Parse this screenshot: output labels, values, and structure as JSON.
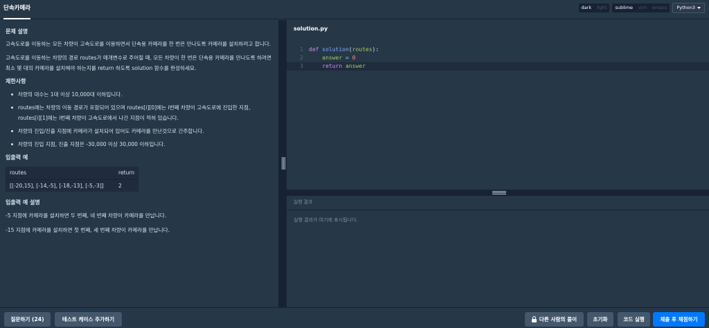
{
  "tab": {
    "title": "단속카메라"
  },
  "toggles": {
    "theme": [
      "dark",
      "light"
    ],
    "keymap": [
      "sublime",
      "vim",
      "emacs"
    ],
    "language": "Python3"
  },
  "problem": {
    "heading": "문제 설명",
    "para1": "고속도로를 이동하는 모든 차량이 고속도로를 이용하면서 단속용 카메라를 한 번은 만나도록 카메라를 설치하려고 합니다.",
    "para2": "고속도로를 이동하는 차량의 경로 routes가 매개변수로 주어질 때, 모든 차량이 한 번은 단속용 카메라를 만나도록 하려면 최소 몇 대의 카메라를 설치해야 하는지를 return 하도록 solution 함수를 완성하세요.",
    "constraints_heading": "제한사항",
    "constraints": [
      "차량의 대수는 1대 이상 10,000대 이하입니다.",
      "routes에는 차량의 이동 경로가 포함되어 있으며 routes[i][0]에는 i번째 차량이 고속도로에 진입한 지점, routes[i][1]에는 i번째 차량이 고속도로에서 나간 지점이 적혀 있습니다.",
      "차량의 진입/진출 지점에 카메라가 설치되어 있어도 카메라를 만난것으로 간주합니다.",
      "차량의 진입 지점, 진출 지점은 -30,000 이상 30,000 이하입니다."
    ],
    "io_heading": "입출력 예",
    "io_table": {
      "headers": [
        "routes",
        "return"
      ],
      "rows": [
        [
          "[[-20,15], [-14,-5], [-18,-13], [-5,-3]]",
          "2"
        ]
      ]
    },
    "io_desc_heading": "입출력 예 설명",
    "io_desc": [
      "-5 지점에 카메라를 설치하면 두 번째, 네 번째 차량이 카메라를 만납니다.",
      "-15 지점에 카메라를 설치하면 첫 번째, 세 번째 차량이 카메라를 만납니다."
    ]
  },
  "editor": {
    "filename": "solution.py",
    "line_numbers": [
      "1",
      "2",
      "3"
    ],
    "code": {
      "l1_def": "def ",
      "l1_fn": "solution",
      "l1_open": "(",
      "l1_param": "routes",
      "l1_close": "):",
      "l2_var": "answer",
      "l2_op": " = ",
      "l2_num": "0",
      "l3_kw": "return ",
      "l3_var": "answer"
    }
  },
  "result": {
    "title": "실행 결과",
    "placeholder": "실행 결과가 여기에 표시됩니다."
  },
  "footer": {
    "ask": "질문하기 (24)",
    "add_testcase": "테스트 케이스 추가하기",
    "others_solution": "다른 사람의 풀이",
    "reset": "초기화",
    "run": "코드 실행",
    "submit": "제출 후 채점하기"
  }
}
